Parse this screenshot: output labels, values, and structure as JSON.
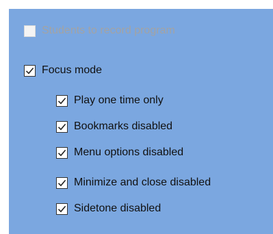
{
  "options": {
    "students_record": {
      "label": "Students to record program",
      "checked": false,
      "enabled": false
    },
    "focus_mode": {
      "label": "Focus mode",
      "checked": true,
      "enabled": true
    },
    "play_once": {
      "label": "Play one time only",
      "checked": true,
      "enabled": true
    },
    "bookmarks_disabled": {
      "label": "Bookmarks disabled",
      "checked": true,
      "enabled": true
    },
    "menu_options_disabled": {
      "label": "Menu options disabled",
      "checked": true,
      "enabled": true
    },
    "minimize_close_disabled": {
      "label": "Minimize and close disabled",
      "checked": true,
      "enabled": true
    },
    "sidetone_disabled": {
      "label": "Sidetone disabled",
      "checked": true,
      "enabled": true
    }
  },
  "colors": {
    "panel_background": "#7ba7e0",
    "disabled_text": "#a3a3a3",
    "text": "#111111"
  }
}
